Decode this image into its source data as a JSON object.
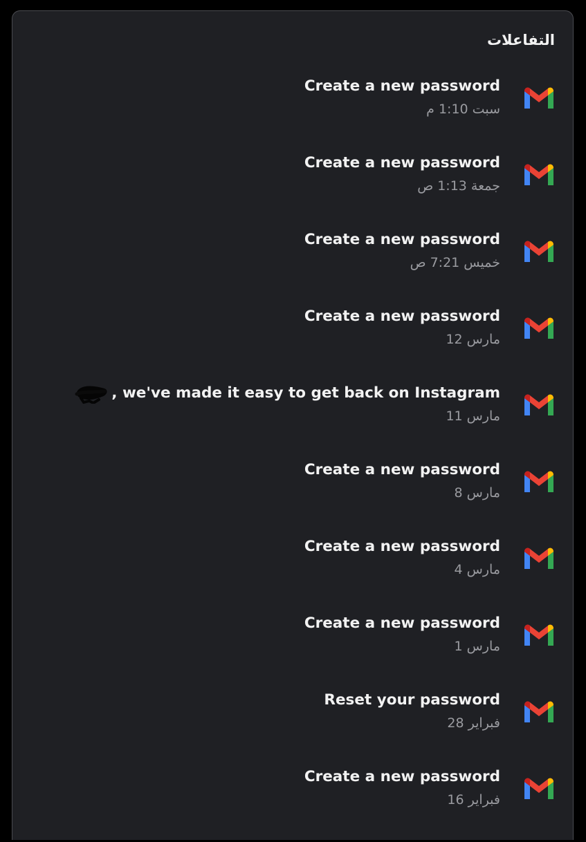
{
  "panel": {
    "title": "التفاعلات"
  },
  "items": [
    {
      "subject": "Create a new password",
      "date": "سبت 1:10 م",
      "icon": "gmail-icon"
    },
    {
      "subject": "Create a new password",
      "date": "جمعة 1:13 ص",
      "icon": "gmail-icon"
    },
    {
      "subject": "Create a new password",
      "date": "خميس 7:21 ص",
      "icon": "gmail-icon"
    },
    {
      "subject": "Create a new password",
      "date": "مارس 12",
      "icon": "gmail-icon"
    },
    {
      "subject": ", we've made it easy to get back on Instagram",
      "date": "مارس 11",
      "icon": "gmail-icon",
      "redacted_prefix": true
    },
    {
      "subject": "Create a new password",
      "date": "مارس 8",
      "icon": "gmail-icon"
    },
    {
      "subject": "Create a new password",
      "date": "مارس 4",
      "icon": "gmail-icon"
    },
    {
      "subject": "Create a new password",
      "date": "مارس 1",
      "icon": "gmail-icon"
    },
    {
      "subject": "Reset your password",
      "date": "فبراير 28",
      "icon": "gmail-icon"
    },
    {
      "subject": "Create a new password",
      "date": "فبراير 16",
      "icon": "gmail-icon"
    }
  ],
  "colors": {
    "background": "#000000",
    "panel": "#1f2024",
    "panel_border": "#4a4b50",
    "text_primary": "#f2f2f2",
    "text_secondary": "#9a9ba0",
    "gmail_blue": "#4285F4",
    "gmail_red": "#EA4335",
    "gmail_yellow": "#FBBC04",
    "gmail_green": "#34A853",
    "gmail_darkred": "#C5221F"
  }
}
